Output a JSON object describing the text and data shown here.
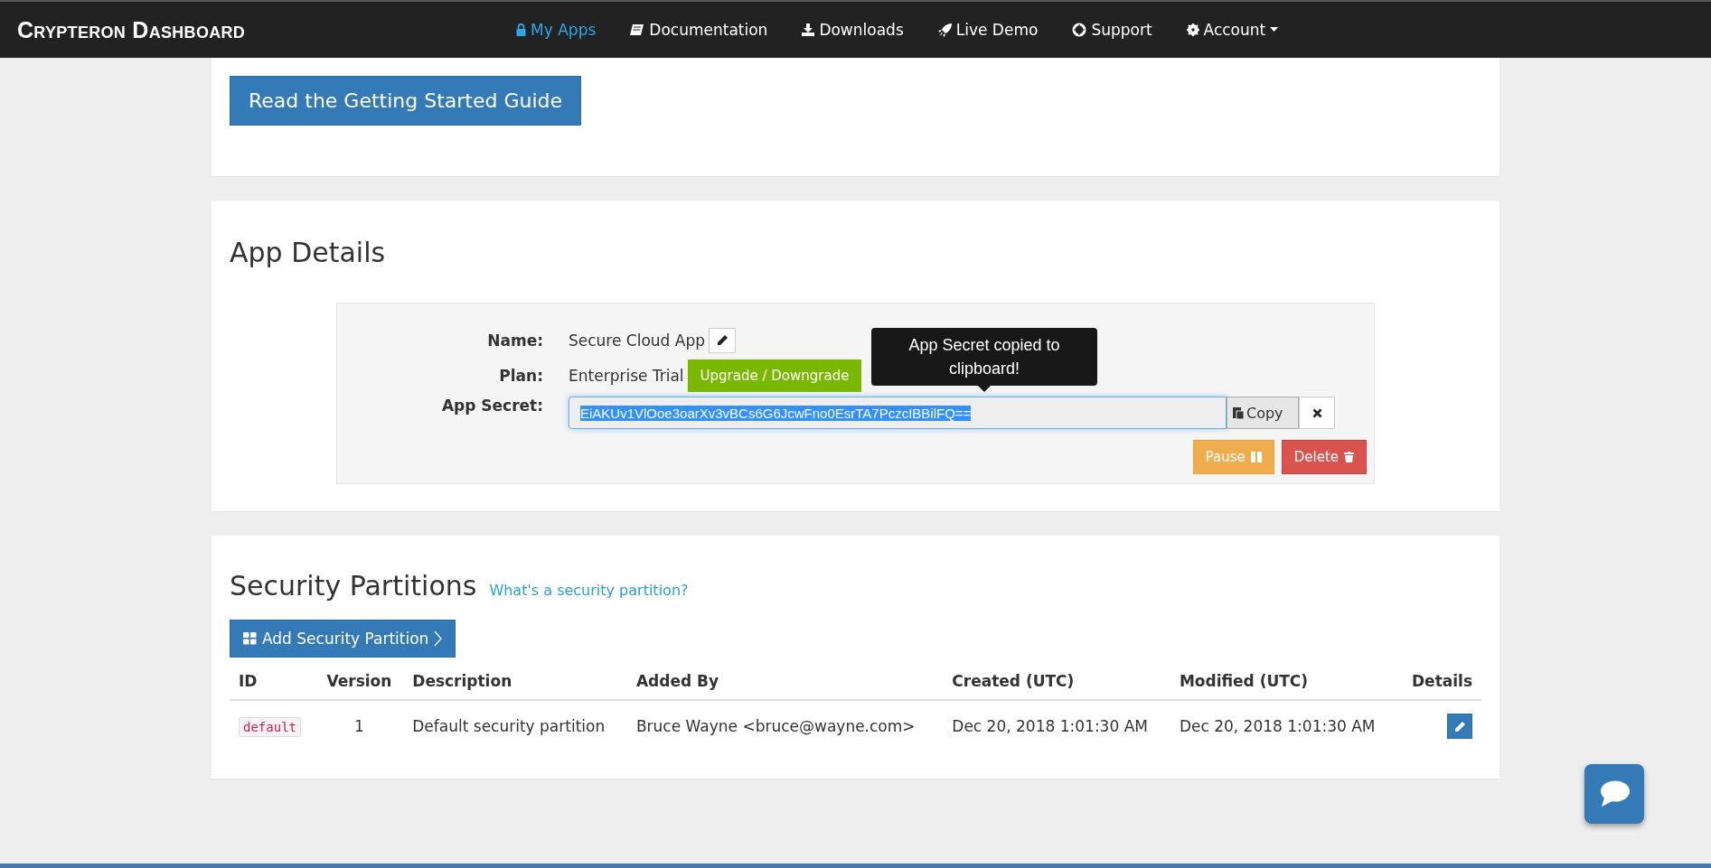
{
  "navbar": {
    "brand": "Crypteron Dashboard",
    "items": [
      {
        "label": "My Apps",
        "selected": true,
        "dropdown": false
      },
      {
        "label": "Documentation",
        "selected": false,
        "dropdown": false
      },
      {
        "label": "Downloads",
        "selected": false,
        "dropdown": false
      },
      {
        "label": "Live Demo",
        "selected": false,
        "dropdown": false
      },
      {
        "label": "Support",
        "selected": false,
        "dropdown": false
      },
      {
        "label": "Account",
        "selected": false,
        "dropdown": true
      }
    ]
  },
  "guide_button": "Read the Getting Started Guide",
  "app_details": {
    "title": "App Details",
    "name_label": "Name:",
    "name": "Secure Cloud App",
    "plan_label": "Plan:",
    "plan": "Enterprise Trial",
    "plan_button": "Upgrade / Downgrade",
    "secret_label": "App Secret:",
    "secret": "EiAKUv1VlOoe3oarXv3vBCs6G6JcwFno0EsrTA7PczcIBBilFQ==",
    "copy_button": "Copy",
    "tooltip": "App Secret copied to clipboard!",
    "pause_button": "Pause",
    "delete_button": "Delete"
  },
  "partitions": {
    "title": "Security Partitions",
    "help_link": "What's a security partition?",
    "add_button": "Add Security Partition",
    "columns": [
      "ID",
      "Version",
      "Description",
      "Added By",
      "Created (UTC)",
      "Modified (UTC)",
      "Details"
    ],
    "rows": [
      {
        "id": "default",
        "version": "1",
        "description": "Default security partition",
        "added_by": "Bruce Wayne <bruce@wayne.com>",
        "created": "Dec 20, 2018 1:01:30 AM",
        "modified": "Dec 20, 2018 1:01:30 AM"
      }
    ]
  }
}
